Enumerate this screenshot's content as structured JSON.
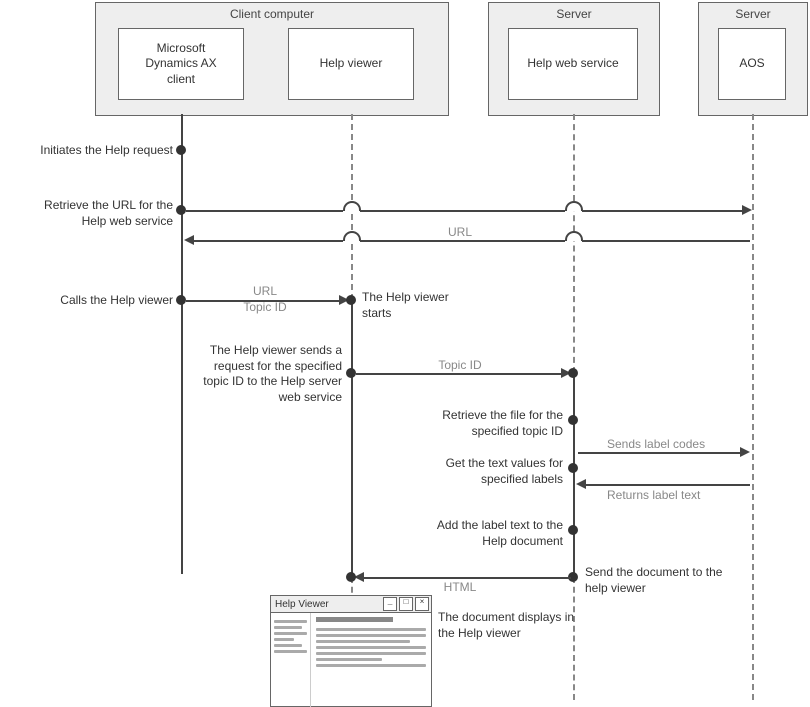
{
  "lanes": {
    "client_computer": {
      "title": "Client computer"
    },
    "server1": {
      "title": "Server"
    },
    "server2": {
      "title": "Server"
    }
  },
  "nodes": {
    "ax_client": "Microsoft\nDynamics AX\nclient",
    "help_viewer": "Help viewer",
    "help_web_service": "Help web service",
    "aos": "AOS"
  },
  "events": {
    "initiate": "Initiates the Help request",
    "retrieve_url": "Retrieve the URL for the\nHelp web service",
    "url_return": "URL",
    "calls_help_viewer": "Calls the Help viewer",
    "url_label": "URL",
    "topic_id_label": "Topic ID",
    "viewer_starts": "The Help viewer\nstarts",
    "viewer_sends": "The Help viewer sends a\nrequest for the specified\ntopic ID to the Help server\nweb service",
    "topic_id_msg": "Topic ID",
    "retrieve_file": "Retrieve the file for the\nspecified topic ID",
    "sends_label_codes": "Sends label codes",
    "get_text_values": "Get the text values for\nspecified labels",
    "returns_label_text": "Returns label text",
    "add_label_text": "Add the label text to the\nHelp document",
    "send_document": "Send the document to the\nhelp viewer",
    "html_msg": "HTML",
    "document_displays": "The document displays in\nthe Help viewer"
  },
  "help_viewer_window": {
    "title": "Help Viewer"
  }
}
